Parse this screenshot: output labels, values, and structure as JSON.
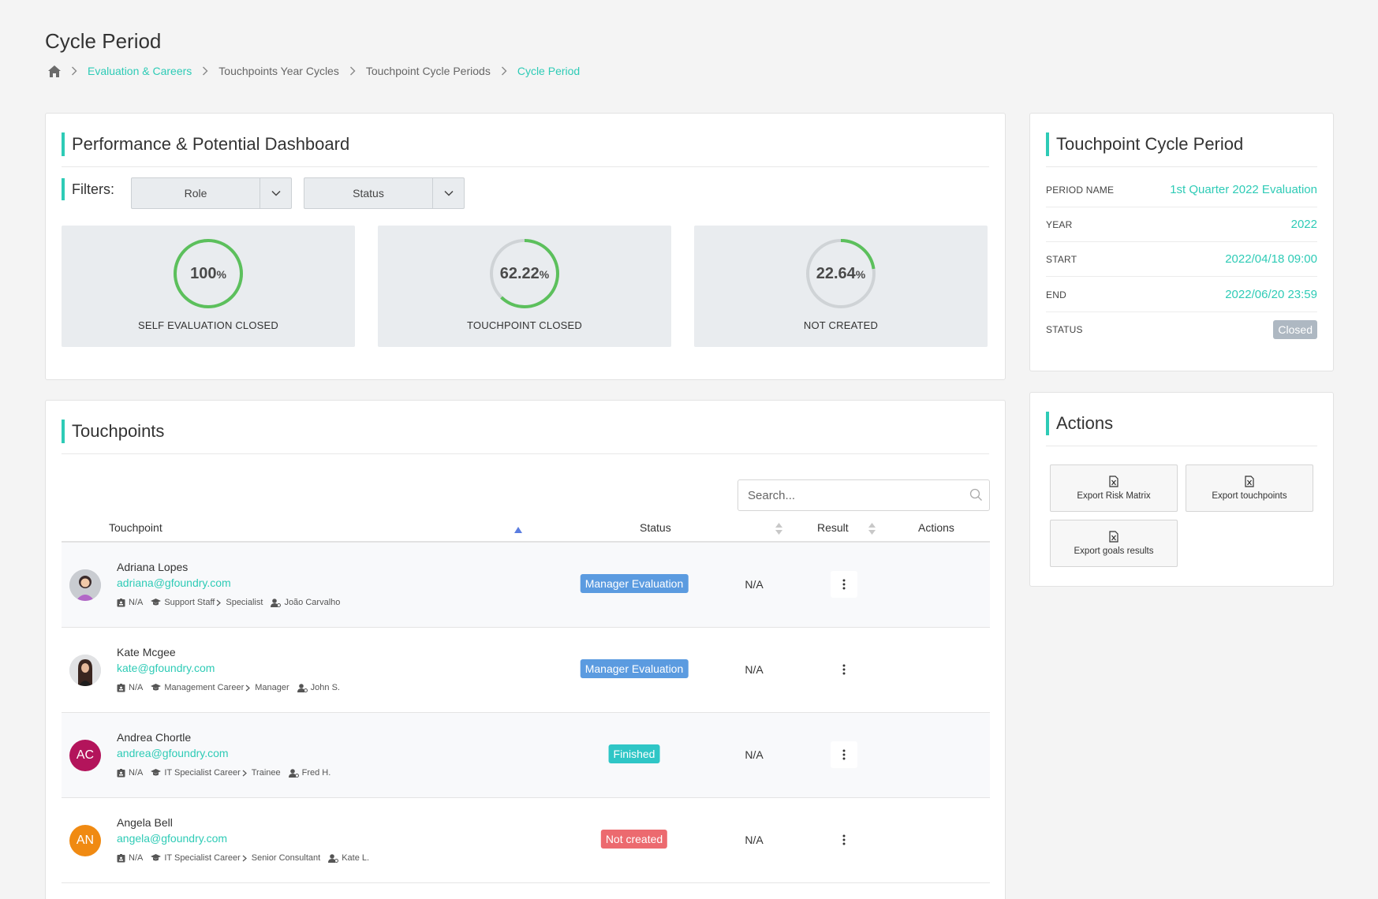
{
  "page": {
    "title": "Cycle Period",
    "breadcrumb": [
      "Evaluation & Careers",
      "Touchpoints Year Cycles",
      "Touchpoint Cycle Periods",
      "Cycle Period"
    ]
  },
  "dashboard": {
    "title": "Performance & Potential Dashboard",
    "filters_label": "Filters:",
    "filters": [
      {
        "label": "Role"
      },
      {
        "label": "Status"
      }
    ],
    "stats": [
      {
        "value": "100",
        "unit": "%",
        "fraction": 1.0,
        "label": "SELF EVALUATION CLOSED"
      },
      {
        "value": "62.22",
        "unit": "%",
        "fraction": 0.6222,
        "label": "TOUCHPOINT CLOSED"
      },
      {
        "value": "22.64",
        "unit": "%",
        "fraction": 0.2264,
        "label": "NOT CREATED"
      }
    ]
  },
  "cycle_period": {
    "title": "Touchpoint Cycle Period",
    "rows": [
      {
        "key": "PERIOD NAME",
        "value": "1st Quarter 2022 Evaluation"
      },
      {
        "key": "YEAR",
        "value": "2022"
      },
      {
        "key": "START",
        "value": "2022/04/18 09:00"
      },
      {
        "key": "END",
        "value": "2022/06/20 23:59"
      },
      {
        "key": "STATUS",
        "value": "Closed"
      }
    ]
  },
  "actions": {
    "title": "Actions",
    "buttons": [
      {
        "label": "Export Risk Matrix"
      },
      {
        "label": "Export touchpoints"
      },
      {
        "label": "Export goals results"
      }
    ]
  },
  "touchpoints": {
    "title": "Touchpoints",
    "search_placeholder": "Search...",
    "columns": {
      "touchpoint": "Touchpoint",
      "status": "Status",
      "result": "Result",
      "actions": "Actions"
    },
    "rows": [
      {
        "name": "Adriana Lopes",
        "email": "adriana@gfoundry.com",
        "id": "N/A",
        "career": "Support Staff",
        "level": "Specialist",
        "manager": "João Carvalho",
        "status": "Manager Evaluation",
        "status_color": "#5b9be0",
        "result": "N/A",
        "initials": "",
        "avatar_color": "#c9ccd1"
      },
      {
        "name": "Kate Mcgee",
        "email": "kate@gfoundry.com",
        "id": "N/A",
        "career": "Management Career",
        "level": "Manager",
        "manager": "John S.",
        "status": "Manager Evaluation",
        "status_color": "#5b9be0",
        "result": "N/A",
        "initials": "",
        "avatar_color": "#d5d7da"
      },
      {
        "name": "Andrea Chortle",
        "email": "andrea@gfoundry.com",
        "id": "N/A",
        "career": "IT Specialist Career",
        "level": "Trainee",
        "manager": "Fred H.",
        "status": "Finished",
        "status_color": "#2fc6c6",
        "result": "N/A",
        "initials": "AC",
        "avatar_color": "#b3145b"
      },
      {
        "name": "Angela Bell",
        "email": "angela@gfoundry.com",
        "id": "N/A",
        "career": "IT Specialist Career",
        "level": "Senior Consultant",
        "manager": "Kate L.",
        "status": "Not created",
        "status_color": "#ec6a6f",
        "result": "N/A",
        "initials": "AN",
        "avatar_color": "#f08a12"
      }
    ]
  }
}
